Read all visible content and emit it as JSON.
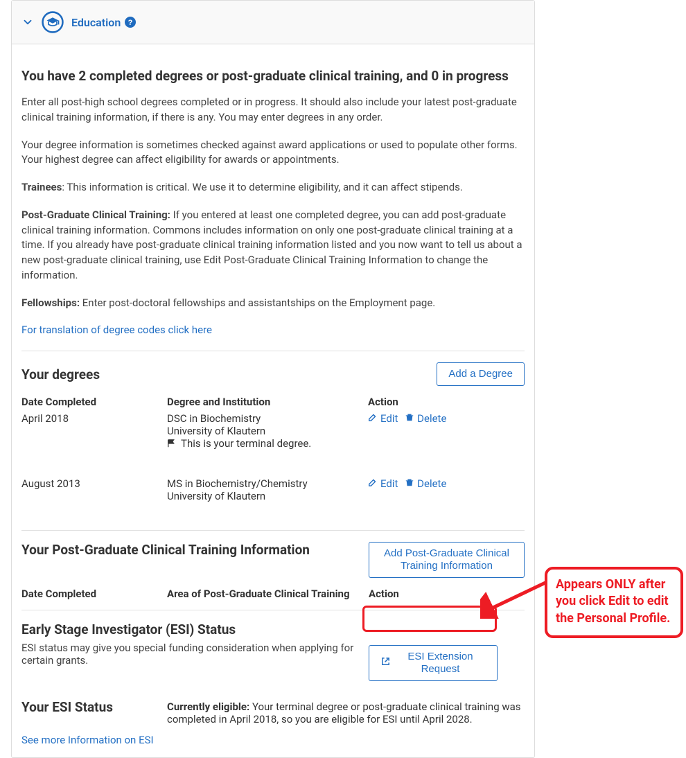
{
  "header": {
    "title": "Education"
  },
  "intro": {
    "summary": "You have 2 completed degrees or post-graduate clinical training, and 0 in progress",
    "p1": "Enter all post-high school degrees completed or in progress. It should also include your latest post-graduate clinical training information, if there is any. You may enter degrees in any order.",
    "p2": "Your degree information is sometimes checked against award applications or used to populate other forms. Your highest degree can affect eligibility for awards or appointments.",
    "trainees_label": "Trainees",
    "trainees_text": ": This information is critical. We use it to determine eligibility, and it can affect stipends.",
    "pgct_label": "Post-Graduate Clinical Training:",
    "pgct_text": " If you entered at least one completed degree, you can add post-graduate clinical training information. Commons includes information on only one post-graduate clinical training at a time. If you already have post-graduate clinical training information listed and you now want to tell us about a new post-graduate clinical training, use Edit Post-Graduate Clinical Training Information to change the information.",
    "fellowships_label": "Fellowships:",
    "fellowships_text": " Enter post-doctoral fellowships and assistantships on the Employment page.",
    "codes_link": "For translation of degree codes click here"
  },
  "degrees": {
    "heading": "Your degrees",
    "add_button": "Add a Degree",
    "col_date": "Date Completed",
    "col_degree": "Degree and Institution",
    "col_action": "Action",
    "edit_label": "Edit",
    "delete_label": "Delete",
    "terminal_note": "This is your terminal degree.",
    "rows": [
      {
        "date": "April 2018",
        "degree": "DSC in Biochemistry",
        "institution": "University of Klautern",
        "terminal": true
      },
      {
        "date": "August 2013",
        "degree": "MS in Biochemistry/Chemistry",
        "institution": "University of Klautern",
        "terminal": false
      }
    ]
  },
  "pgct": {
    "heading": "Your Post-Graduate Clinical Training Information",
    "add_button": "Add Post-Graduate Clinical Training Information",
    "col_date": "Date Completed",
    "col_area": "Area of Post-Graduate Clinical Training",
    "col_action": "Action"
  },
  "esi": {
    "heading": "Early Stage Investigator (ESI) Status",
    "desc": "ESI status may give you special funding consideration when applying for certain grants.",
    "button": "ESI Extension Request",
    "your_status_heading": "Your ESI Status",
    "currently_label": "Currently eligible:",
    "currently_text": " Your terminal degree or post-graduate clinical training was completed in April 2018, so you are eligible for ESI until April 2028.",
    "see_more": "See more Information on ESI"
  },
  "callout": {
    "text": "Appears ONLY after you click Edit to edit the Personal Profile."
  }
}
